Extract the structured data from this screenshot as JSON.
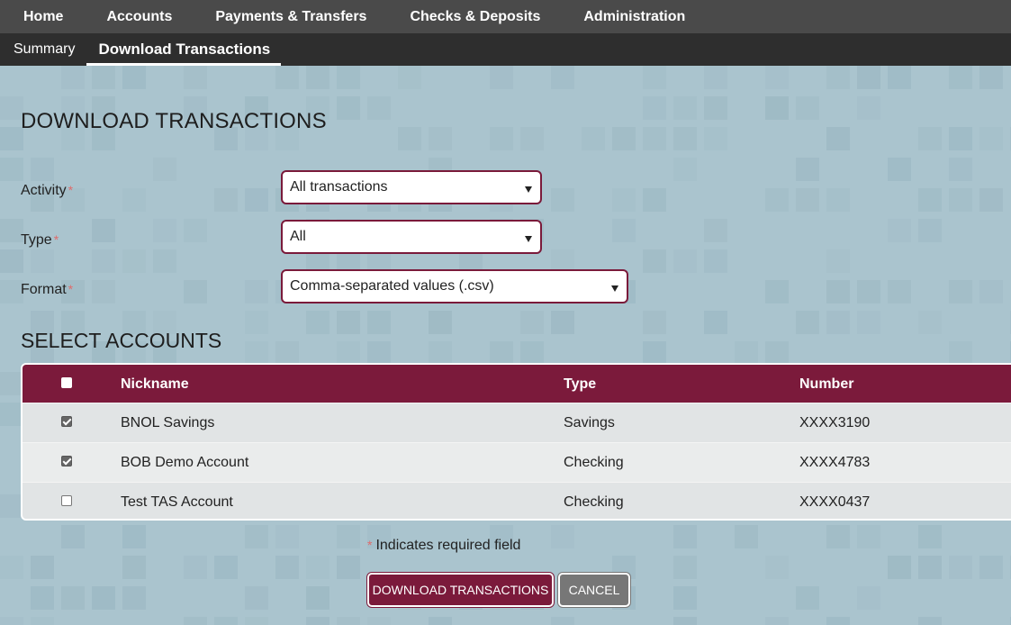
{
  "topnav": {
    "items": [
      "Home",
      "Accounts",
      "Payments & Transfers",
      "Checks & Deposits",
      "Administration"
    ]
  },
  "subnav": {
    "items": [
      "Summary",
      "Download Transactions"
    ],
    "active": "Download Transactions"
  },
  "page": {
    "title": "DOWNLOAD TRANSACTIONS",
    "required_marker": "*"
  },
  "form": {
    "activity": {
      "label": "Activity",
      "value": "All transactions"
    },
    "type": {
      "label": "Type",
      "value": "All"
    },
    "format": {
      "label": "Format",
      "value": "Comma-separated values (.csv)"
    }
  },
  "accounts": {
    "title": "SELECT ACCOUNTS",
    "columns": {
      "nickname": "Nickname",
      "type": "Type",
      "number": "Number"
    },
    "select_all_checked": false,
    "rows": [
      {
        "checked": true,
        "nickname": "BNOL Savings",
        "type": "Savings",
        "number": "XXXX3190"
      },
      {
        "checked": true,
        "nickname": "BOB Demo Account",
        "type": "Checking",
        "number": "XXXX4783"
      },
      {
        "checked": false,
        "nickname": "Test TAS Account",
        "type": "Checking",
        "number": "XXXX0437"
      }
    ]
  },
  "footer": {
    "required_note": "Indicates required field",
    "download_label": "DOWNLOAD TRANSACTIONS",
    "cancel_label": "CANCEL"
  },
  "colors": {
    "brand": "#7b1a3b",
    "topnav": "#4a4a4a",
    "subnav": "#2e2e2e",
    "background": "#aac4ce",
    "cancel": "#777777",
    "required": "#e06b6b"
  }
}
